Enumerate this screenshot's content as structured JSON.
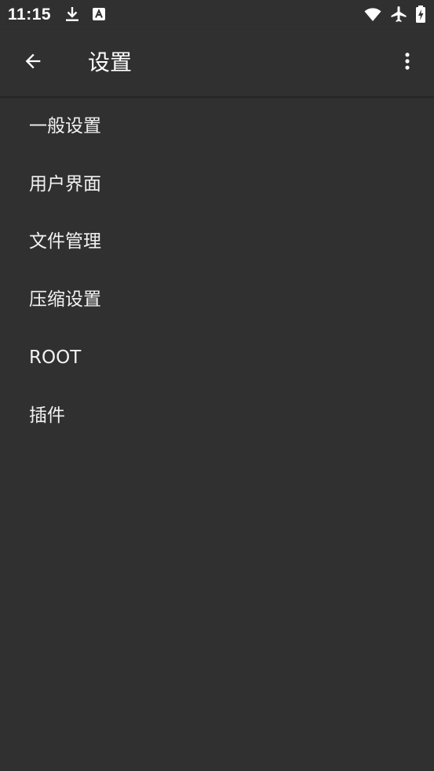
{
  "status_bar": {
    "time": "11:15",
    "icons": [
      "download-icon",
      "a-notification-icon",
      "wifi-icon",
      "airplane-mode-icon",
      "battery-charging-icon"
    ]
  },
  "app_bar": {
    "back_icon": "arrow-left-icon",
    "title": "设置",
    "more_icon": "more-vertical-icon"
  },
  "settings": {
    "items": [
      {
        "label": "一般设置"
      },
      {
        "label": "用户界面"
      },
      {
        "label": "文件管理"
      },
      {
        "label": "压缩设置"
      },
      {
        "label": "ROOT"
      },
      {
        "label": "插件"
      }
    ]
  },
  "colors": {
    "background": "#303030",
    "text": "#ffffff"
  }
}
